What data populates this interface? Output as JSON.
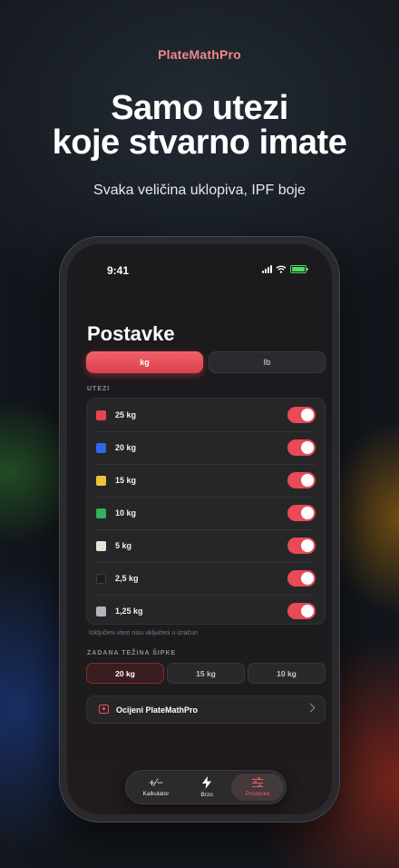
{
  "hero": {
    "brand": "PlateMathPro",
    "headline_line1": "Samo utezi",
    "headline_line2": "koje stvarno imate",
    "subline": "Svaka veličina uklopiva, IPF boje"
  },
  "status_bar": {
    "time": "9:41"
  },
  "screen": {
    "title": "Postavke",
    "units": {
      "kg": "kg",
      "lb": "lb",
      "selected": "kg"
    },
    "plates_section_label": "UTEZI",
    "plates": [
      {
        "label": "25 kg",
        "color": "#e5434f",
        "enabled": true
      },
      {
        "label": "20 kg",
        "color": "#2f67e6",
        "enabled": true
      },
      {
        "label": "15 kg",
        "color": "#f0c43a",
        "enabled": true
      },
      {
        "label": "10 kg",
        "color": "#34b05a",
        "enabled": true
      },
      {
        "label": "5 kg",
        "color": "#e6e2d6",
        "enabled": true
      },
      {
        "label": "2,5 kg",
        "color": "#1c1c1f",
        "enabled": true
      },
      {
        "label": "1,25 kg",
        "color": "#b4b4b8",
        "enabled": true
      }
    ],
    "plates_note": "Isključeni utezi nisu uključeni u izračun",
    "bar_section_label": "ZADANA TEŽINA ŠIPKE",
    "bar_options": [
      {
        "label": "20 kg",
        "selected": true
      },
      {
        "label": "15 kg",
        "selected": false
      },
      {
        "label": "10 kg",
        "selected": false
      }
    ],
    "rate_label": "Ocijeni PlateMathPro"
  },
  "tabbar": {
    "tabs": [
      {
        "label": "Kalkulator",
        "icon": "plus-minus-icon"
      },
      {
        "label": "Brzo",
        "icon": "bolt-icon"
      },
      {
        "label": "Postavke",
        "icon": "sliders-icon",
        "active": true
      }
    ]
  }
}
